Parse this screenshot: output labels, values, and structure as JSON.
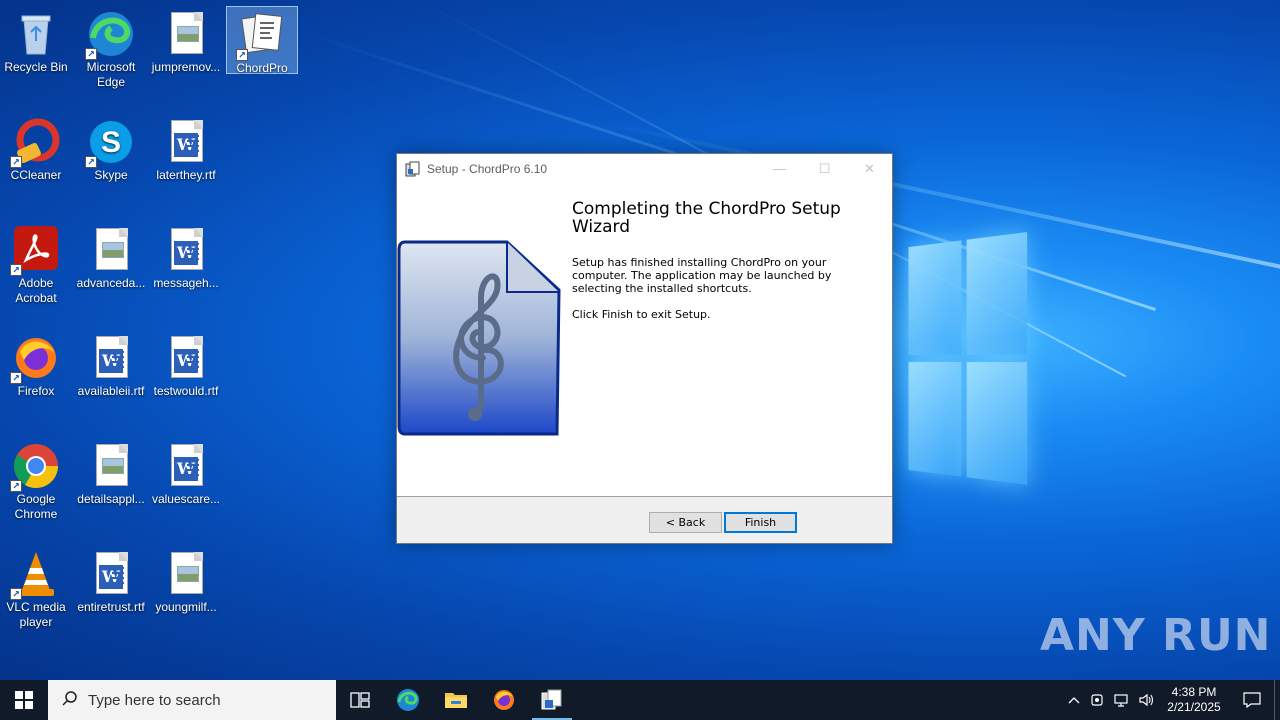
{
  "desktop": {
    "icons": [
      {
        "label": "Recycle Bin"
      },
      {
        "label": "Microsoft Edge"
      },
      {
        "label": "jumpremov..."
      },
      {
        "label": "ChordPro"
      },
      {
        "label": "CCleaner"
      },
      {
        "label": "Skype"
      },
      {
        "label": "laterthey.rtf"
      },
      {
        "label": "Adobe Acrobat"
      },
      {
        "label": "advanceda..."
      },
      {
        "label": "messageh..."
      },
      {
        "label": "Firefox"
      },
      {
        "label": "availableii.rtf"
      },
      {
        "label": "testwould.rtf"
      },
      {
        "label": "Google Chrome"
      },
      {
        "label": "detailsappl..."
      },
      {
        "label": "valuescare..."
      },
      {
        "label": "VLC media player"
      },
      {
        "label": "entiretrust.rtf"
      },
      {
        "label": "youngmilf..."
      }
    ],
    "selected_icon": "ChordPro",
    "watermark": "ANY RUN"
  },
  "dialog": {
    "title": "Setup - ChordPro 6.10",
    "heading": "Completing the ChordPro Setup Wizard",
    "paragraph1": "Setup has finished installing ChordPro on your computer. The application may be launched by selecting the installed shortcuts.",
    "paragraph2": "Click Finish to exit Setup.",
    "back_label": "< Back",
    "finish_label": "Finish",
    "controls": {
      "minimize": "—",
      "maximize": "☐",
      "close": "✕"
    }
  },
  "taskbar": {
    "search_placeholder": "Type here to search",
    "pinned": [
      "task-view",
      "edge",
      "file-explorer",
      "firefox",
      "chordpro-setup"
    ],
    "active": "chordpro-setup",
    "clock_time": "4:38 PM",
    "clock_date": "2/21/2025"
  },
  "colors": {
    "accent": "#0078d7",
    "taskbar": "#101a28",
    "wallpaper": "#0a66d8"
  }
}
